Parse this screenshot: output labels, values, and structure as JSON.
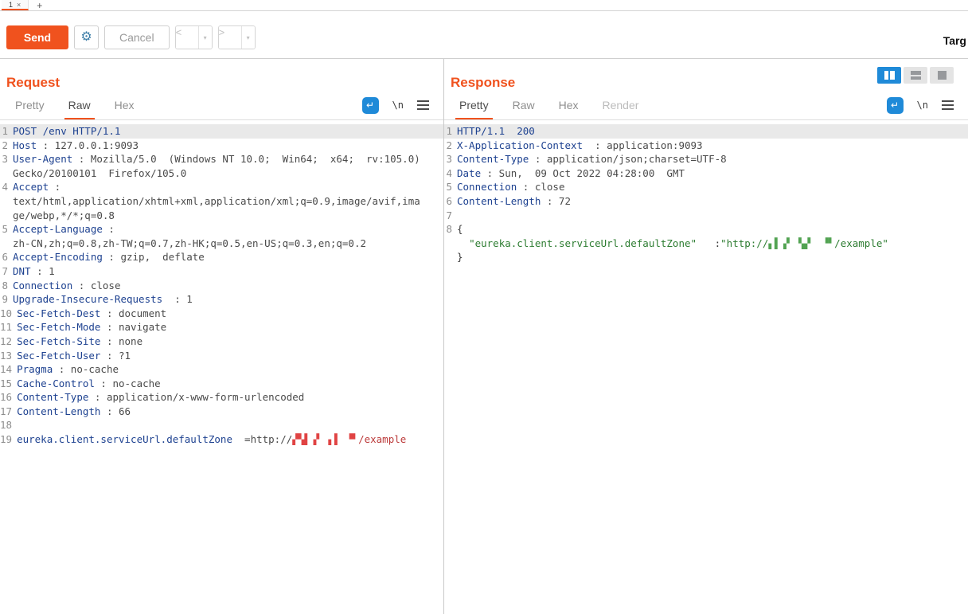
{
  "colors": {
    "accent": "#f0521e",
    "blue": "#1f8ad8"
  },
  "window": {
    "tab_label": "1",
    "tab_close_glyph": "×",
    "new_tab_glyph": "+",
    "target_label": "Targ"
  },
  "toolbar": {
    "send_label": "Send",
    "cancel_label": "Cancel",
    "back_glyph": "<",
    "forward_glyph": ">",
    "dropdown_glyph": "▾",
    "gear_glyph": "⚙"
  },
  "editor_icons": {
    "wrap_glyph": "↵",
    "newline_glyph": "\\n"
  },
  "request": {
    "title": "Request",
    "tabs": {
      "pretty": "Pretty",
      "raw": "Raw",
      "hex": "Hex"
    },
    "active_tab": "Raw",
    "lines": [
      {
        "n": "1",
        "hl": true,
        "seg": [
          [
            "POST /env HTTP/1.1",
            "k"
          ]
        ]
      },
      {
        "n": "2",
        "seg": [
          [
            "Host",
            "k"
          ],
          [
            " : 127.0.0.1:9093",
            "v"
          ]
        ]
      },
      {
        "n": "3",
        "seg": [
          [
            "User-Agent",
            "k"
          ],
          [
            " : Mozilla/5.0  (Windows NT 10.0;  Win64;  x64;  rv:105.0)",
            "v"
          ]
        ]
      },
      {
        "n": "",
        "seg": [
          [
            "Gecko/20100101  Firefox/105.0",
            "v"
          ]
        ]
      },
      {
        "n": "4",
        "seg": [
          [
            "Accept",
            "k"
          ],
          [
            " :",
            "v"
          ]
        ]
      },
      {
        "n": "",
        "seg": [
          [
            "text/html,application/xhtml+xml,application/xml;q=0.9,image/avif,ima",
            "v"
          ]
        ]
      },
      {
        "n": "",
        "seg": [
          [
            "ge/webp,*/*;q=0.8",
            "v"
          ]
        ]
      },
      {
        "n": "5",
        "seg": [
          [
            "Accept-Language",
            "k"
          ],
          [
            " :",
            "v"
          ]
        ]
      },
      {
        "n": "",
        "seg": [
          [
            "zh-CN,zh;q=0.8,zh-TW;q=0.7,zh-HK;q=0.5,en-US;q=0.3,en;q=0.2",
            "v"
          ]
        ]
      },
      {
        "n": "6",
        "seg": [
          [
            "Accept-Encoding",
            "k"
          ],
          [
            " : gzip,  deflate",
            "v"
          ]
        ]
      },
      {
        "n": "7",
        "seg": [
          [
            "DNT",
            "k"
          ],
          [
            " : 1",
            "v"
          ]
        ]
      },
      {
        "n": "8",
        "seg": [
          [
            "Connection",
            "k"
          ],
          [
            " : close",
            "v"
          ]
        ]
      },
      {
        "n": "9",
        "seg": [
          [
            "Upgrade-Insecure-Requests",
            "k"
          ],
          [
            "  : 1",
            "v"
          ]
        ]
      },
      {
        "n": "10",
        "seg": [
          [
            "Sec-Fetch-Dest",
            "k"
          ],
          [
            " : document",
            "v"
          ]
        ]
      },
      {
        "n": "11",
        "seg": [
          [
            "Sec-Fetch-Mode",
            "k"
          ],
          [
            " : navigate",
            "v"
          ]
        ]
      },
      {
        "n": "12",
        "seg": [
          [
            "Sec-Fetch-Site",
            "k"
          ],
          [
            " : none",
            "v"
          ]
        ]
      },
      {
        "n": "13",
        "seg": [
          [
            "Sec-Fetch-User",
            "k"
          ],
          [
            " : ?1",
            "v"
          ]
        ]
      },
      {
        "n": "14",
        "seg": [
          [
            "Pragma",
            "k"
          ],
          [
            " : no-cache",
            "v"
          ]
        ]
      },
      {
        "n": "15",
        "seg": [
          [
            "Cache-Control",
            "k"
          ],
          [
            " : no-cache",
            "v"
          ]
        ]
      },
      {
        "n": "16",
        "seg": [
          [
            "Content-Type",
            "k"
          ],
          [
            " : application/x-www-form-urlencoded",
            "v"
          ]
        ]
      },
      {
        "n": "17",
        "seg": [
          [
            "Content-Length",
            "k"
          ],
          [
            " : 66",
            "v"
          ]
        ]
      },
      {
        "n": "18",
        "seg": []
      },
      {
        "n": "19",
        "seg": [
          [
            "eureka.client.serviceUrl.defaultZone",
            "k"
          ],
          [
            "  =http://",
            "v"
          ],
          [
            "▞▚▌▗▘ ▖▌ ▝▘",
            "rb"
          ],
          [
            "/example",
            "rt"
          ]
        ]
      }
    ]
  },
  "response": {
    "title": "Response",
    "tabs": {
      "pretty": "Pretty",
      "raw": "Raw",
      "hex": "Hex",
      "render": "Render"
    },
    "active_tab": "Pretty",
    "lines": [
      {
        "n": "1",
        "hl": true,
        "seg": [
          [
            "HTTP/1.1  200",
            "k"
          ]
        ]
      },
      {
        "n": "2",
        "seg": [
          [
            "X-Application-Context",
            "k"
          ],
          [
            "  : application:9093",
            "v"
          ]
        ]
      },
      {
        "n": "3",
        "seg": [
          [
            "Content-Type",
            "k"
          ],
          [
            " : application/json;charset=UTF-8",
            "v"
          ]
        ]
      },
      {
        "n": "4",
        "seg": [
          [
            "Date",
            "k"
          ],
          [
            " : Sun,  09 Oct 2022 04:28:00  GMT",
            "v"
          ]
        ]
      },
      {
        "n": "5",
        "seg": [
          [
            "Connection",
            "k"
          ],
          [
            " : close",
            "v"
          ]
        ]
      },
      {
        "n": "6",
        "seg": [
          [
            "Content-Length",
            "k"
          ],
          [
            " : 72",
            "v"
          ]
        ]
      },
      {
        "n": "7",
        "seg": []
      },
      {
        "n": "8",
        "seg": [
          [
            "{",
            "p"
          ]
        ]
      },
      {
        "n": "",
        "seg": [
          [
            "  ",
            "p"
          ],
          [
            "\"eureka.client.serviceUrl.defaultZone\"",
            "gv"
          ],
          [
            "   :",
            "p"
          ],
          [
            "\"http://",
            "gv"
          ],
          [
            "▖▌▗▘ ▚▞  ▝▘",
            "gb"
          ],
          [
            "/example\"",
            "gv"
          ]
        ]
      },
      {
        "n": "",
        "seg": [
          [
            "}",
            "p"
          ]
        ]
      }
    ]
  }
}
